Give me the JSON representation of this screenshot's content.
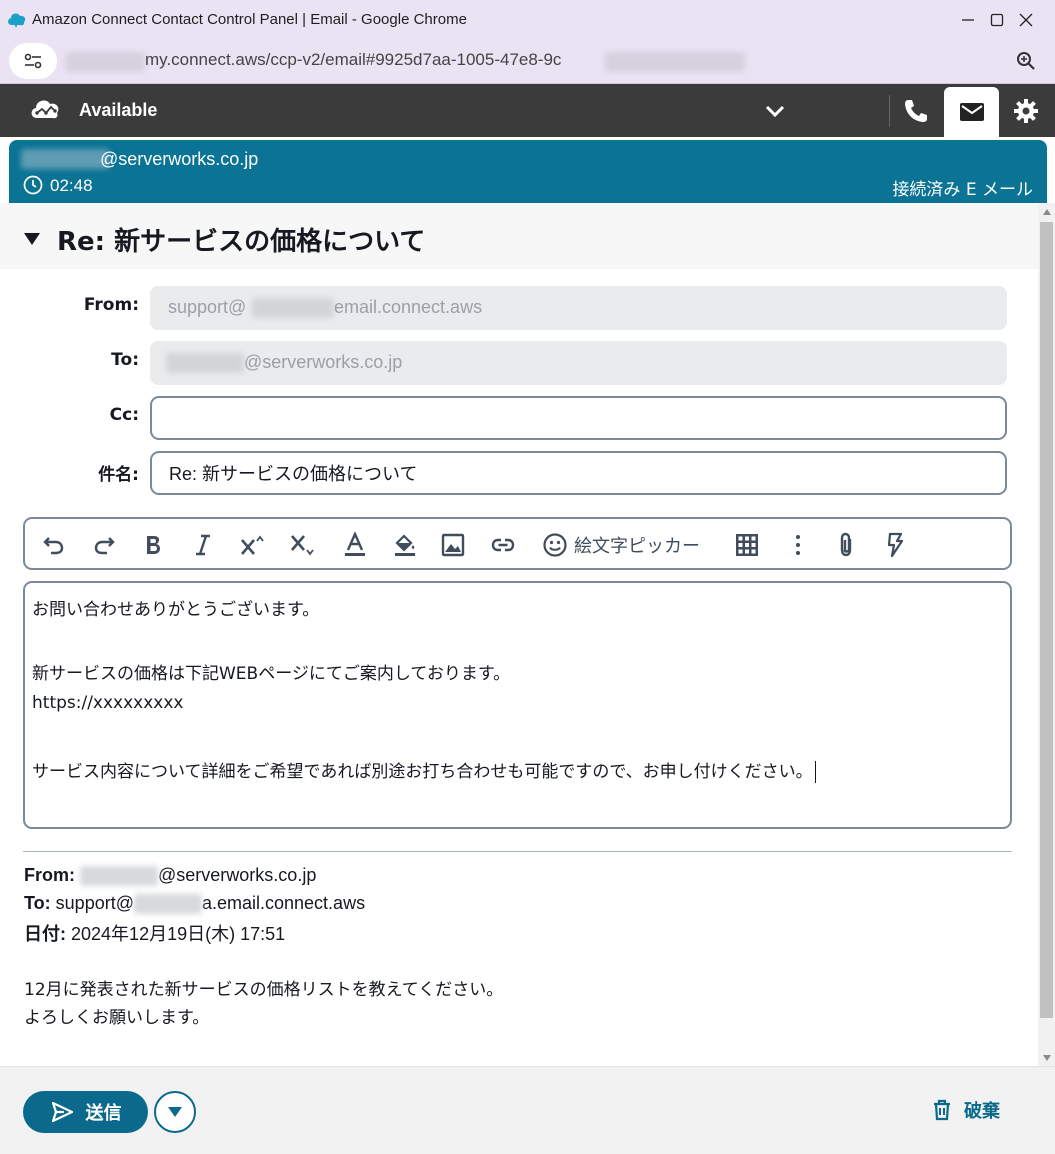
{
  "window": {
    "title": "Amazon Connect Contact Control Panel | Email - Google Chrome",
    "url": "my.connect.aws/ccp-v2/email#9925d7aa-1005-47e8-9c"
  },
  "header": {
    "status": "Available"
  },
  "contact": {
    "address": "@serverworks.co.jp",
    "timer": "02:48",
    "state": "接続済み E メール"
  },
  "email": {
    "subject_title": "Re: 新サービスの価格について",
    "from_label": "From:",
    "from_prefix": "support@",
    "from_suffix": "email.connect.aws",
    "to_label": "To:",
    "to_value": "@serverworks.co.jp",
    "cc_label": "Cc:",
    "cc_value": "",
    "subject_label": "件名:",
    "subject_value": "Re: 新サービスの価格について"
  },
  "toolbar": {
    "emoji_label": "絵文字ピッカー"
  },
  "body_lines": [
    "お問い合わせありがとうございます。",
    "新サービスの価格は下記WEBページにてご案内しております。",
    "https://xxxxxxxxx",
    "サービス内容について詳細をご希望であれば別途お打ち合わせも可能ですので、お申し付けください。"
  ],
  "quoted": {
    "from_label": "From:",
    "from_value": "@serverworks.co.jp",
    "to_label": "To:",
    "to_prefix": "support@",
    "to_suffix": "a.email.connect.aws",
    "date_label": "日付:",
    "date_value": "2024年12月19日(木) 17:51",
    "line1": "12月に発表された新サービスの価格リストを教えてください。",
    "line2": "よろしくお願いします。"
  },
  "footer": {
    "send_label": "送信",
    "discard_label": "破棄"
  },
  "colors": {
    "accent": "#0b6a8c",
    "banner": "#0b7394",
    "header_bg": "#3b3b3b",
    "chrome_bg": "#eae3f4"
  }
}
